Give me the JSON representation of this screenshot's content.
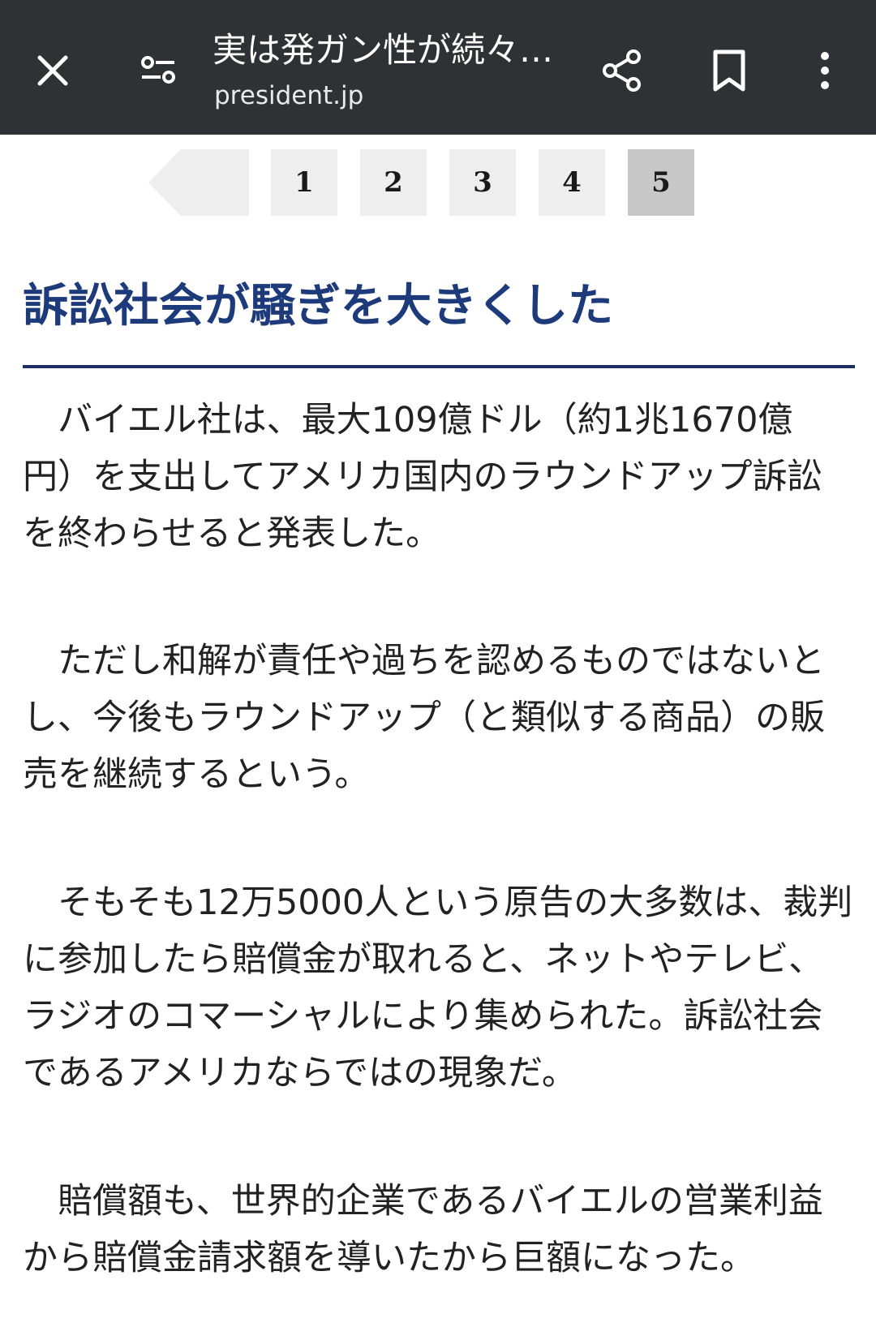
{
  "toolbar": {
    "title": "実は発ガン性が続々…",
    "url": "president.jp",
    "icons": {
      "close": "close-icon",
      "page_settings": "tune-icon",
      "share": "share-icon",
      "bookmark": "bookmark-icon",
      "more": "more-vert-icon"
    }
  },
  "pager": {
    "prev_icon": "prev-arrow-icon",
    "pages": [
      "1",
      "2",
      "3",
      "4",
      "5"
    ],
    "current": "5"
  },
  "article": {
    "heading": "訴訟社会が騒ぎを大きくした",
    "paragraphs": [
      {
        "lines": [
          "　バイエル社は、最大109億ドル（約1兆1670億",
          "円）を支出してアメリカ国内のラウンドアップ訴訟",
          "を終わらせると発表した。"
        ]
      },
      {
        "lines": [
          "　ただし和解が責任や過ちを認めるものではないと",
          "し、今後もラウンドアップ（と類似する商品）の販",
          "売を継続するという。"
        ]
      },
      {
        "lines": [
          "　そもそも12万5000人という原告の大多数は、裁判",
          "に参加したら賠償金が取れると、ネットやテレビ、",
          "ラジオのコマーシャルにより集められた。訴訟社会",
          "であるアメリカならではの現象だ。"
        ]
      },
      {
        "lines": [
          "　賠償額も、世界的企業であるバイエルの営業利益",
          "から賠償金請求額を導いたから巨額になった。"
        ]
      }
    ]
  },
  "colors": {
    "toolbar_bg": "#303134",
    "heading": "#1d3a7a",
    "rule": "#1d2f63",
    "page_bg": "#eeeeee",
    "page_current_bg": "#c8c8c8"
  }
}
